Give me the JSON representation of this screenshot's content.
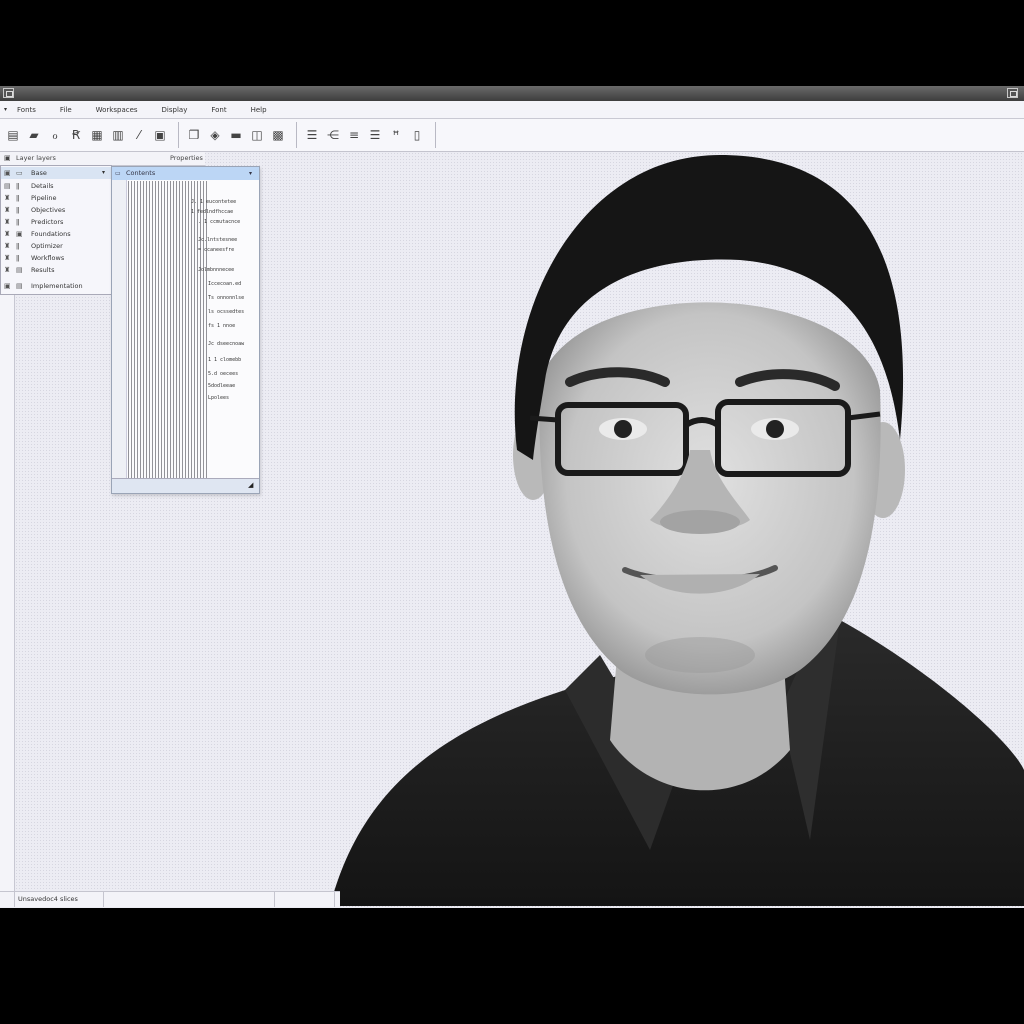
{
  "window": {
    "title_icon": "window-icon",
    "close_icon": "maximize-icon"
  },
  "menubar": {
    "items": [
      "Fonts",
      "File",
      "Workspaces",
      "Display",
      "Font",
      "Help"
    ]
  },
  "toolbar": {
    "icons": [
      "image-icon",
      "folder-icon",
      "lasso-icon",
      "text-tool-icon",
      "layers-icon",
      "columns-icon",
      "brush-icon",
      "page-icon",
      "copy-icon",
      "paint-bucket-icon",
      "fill-icon",
      "stack-icon",
      "grid-icon",
      "list-icon",
      "align-icon",
      "justify-icon",
      "text-height-icon",
      "document-icon"
    ]
  },
  "layers": {
    "header_left": "Layer layers",
    "header_right": "Properties",
    "rows": [
      {
        "label": "Base",
        "selected": true
      },
      {
        "label": "Details"
      },
      {
        "label": "Pipeline"
      },
      {
        "label": "Objectives"
      },
      {
        "label": "Predictors"
      },
      {
        "label": "Foundations"
      },
      {
        "label": "Optimizer"
      },
      {
        "label": "Workflows"
      },
      {
        "label": "Results"
      },
      {
        "label": "Implementation"
      }
    ]
  },
  "dialog": {
    "title": "Contents",
    "lines": [
      "J. 1 eucontetee",
      "1 fedlndfhccae",
      ". 1 ccmutacnce",
      "Jc.lntstesnee",
      "= ccaneesfre",
      "Jolmbnnnecee",
      "Iccecoan.ed",
      "Ts onnonnlse",
      "ls ocssedtes",
      "fs 1 nnoe",
      "Jc dseecnoaw",
      "1 1 clomebb",
      "5.d oecees",
      "5dodleeae",
      "Lpolees"
    ]
  },
  "statusbar": {
    "text": "Unsavedoc4 slices"
  },
  "portrait": {
    "bg": "#ececf3",
    "shirt": "#1f1f1f",
    "skin": "#cfcfcf",
    "hair": "#151515"
  }
}
